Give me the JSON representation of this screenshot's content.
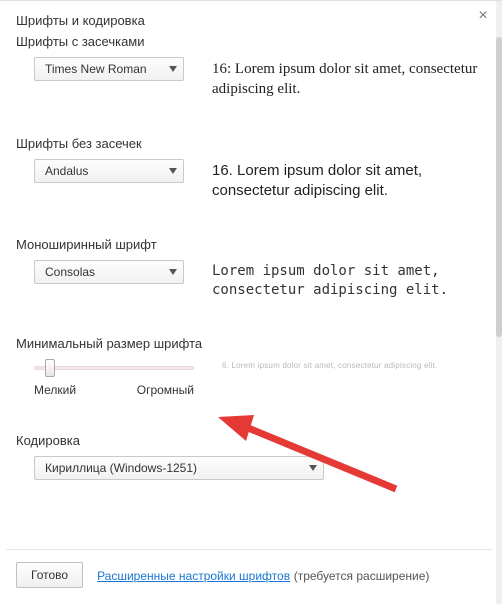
{
  "header": {
    "title": "Шрифты и кодировка"
  },
  "sections": {
    "serif": {
      "label": "Шрифты с засечками",
      "select": "Times New Roman",
      "sample": "16: Lorem ipsum dolor sit amet, consectetur adipiscing elit."
    },
    "sans": {
      "label": "Шрифты без засечек",
      "select": "Andalus",
      "sample": "16. Lorem ipsum dolor sit amet, consectetur adipiscing elit."
    },
    "mono": {
      "label": "Моноширинный шрифт",
      "select": "Consolas",
      "sample": "Lorem ipsum dolor sit amet, consectetur adipiscing elit."
    },
    "min": {
      "label": "Минимальный размер шрифта",
      "slider_min_label": "Мелкий",
      "slider_max_label": "Огромный",
      "sample": "6. Lorem ipsum dolor sit amet, consectetur adipiscing elit."
    },
    "enc": {
      "label": "Кодировка",
      "select": "Кириллица (Windows-1251)"
    }
  },
  "footer": {
    "done": "Готово",
    "link": "Расширенные настройки шрифтов",
    "hint": "(требуется расширение)"
  }
}
